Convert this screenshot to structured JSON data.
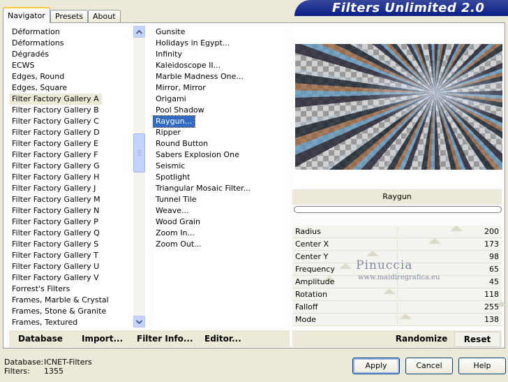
{
  "banner_title": "Filters Unlimited 2.0",
  "tabs": [
    "Navigator",
    "Presets",
    "About"
  ],
  "categories": [
    "Déformation",
    "Déformations",
    "Dégradés",
    "ECWS",
    "Edges, Round",
    "Edges, Square",
    "Filter Factory Gallery A",
    "Filter Factory Gallery B",
    "Filter Factory Gallery C",
    "Filter Factory Gallery D",
    "Filter Factory Gallery E",
    "Filter Factory Gallery F",
    "Filter Factory Gallery G",
    "Filter Factory Gallery H",
    "Filter Factory Gallery J",
    "Filter Factory Gallery M",
    "Filter Factory Gallery N",
    "Filter Factory Gallery P",
    "Filter Factory Gallery Q",
    "Filter Factory Gallery S",
    "Filter Factory Gallery T",
    "Filter Factory Gallery U",
    "Filter Factory Gallery V",
    "Forrest's Filters",
    "Frames, Marble & Crystal",
    "Frames, Stone & Granite",
    "Frames, Textured"
  ],
  "selected_category": "Filter Factory Gallery A",
  "filters": [
    "Gunsite",
    "Holidays in Egypt...",
    "Infinity",
    "Kaleidoscope II...",
    "Marble Madness One...",
    "Mirror, Mirror",
    "Origami",
    "Pool Shadow",
    "Raygun...",
    "Ripper",
    "Round Button",
    "Sabers Explosion One",
    "Seismic",
    "Spotlight",
    "Triangular Mosaic Filter...",
    "Tunnel Tile",
    "Weave...",
    "Wood Grain",
    "Zoom In...",
    "Zoom Out..."
  ],
  "selected_filter": "Raygun...",
  "preview_title": "Raygun",
  "params": [
    {
      "name": "Radius",
      "value": "200",
      "level": 200
    },
    {
      "name": "Center X",
      "value": "173",
      "level": 173
    },
    {
      "name": "Center Y",
      "value": "98",
      "level": 98
    },
    {
      "name": "Frequency",
      "value": "65",
      "level": 65
    },
    {
      "name": "Amplitude",
      "value": "45",
      "level": 45
    },
    {
      "name": "Rotation",
      "value": "118",
      "level": 118
    },
    {
      "name": "Falloff",
      "value": "255",
      "level": 255
    },
    {
      "name": "Mode",
      "value": "138",
      "level": 138
    }
  ],
  "left_buttons": {
    "database": "Database",
    "import": "Import...",
    "filter_info": "Filter Info...",
    "editor": "Editor..."
  },
  "right_buttons": {
    "randomize": "Randomize",
    "reset": "Reset"
  },
  "watermark": {
    "line1": "Pinuccia",
    "line2": "www.maidiregrafica.eu"
  },
  "info": {
    "database_label": "Database:",
    "database_value": "ICNET-Filters",
    "filters_label": "Filters:",
    "filters_value": "1355"
  },
  "dialog_buttons": {
    "apply": "Apply",
    "cancel": "Cancel",
    "help": "Help"
  }
}
